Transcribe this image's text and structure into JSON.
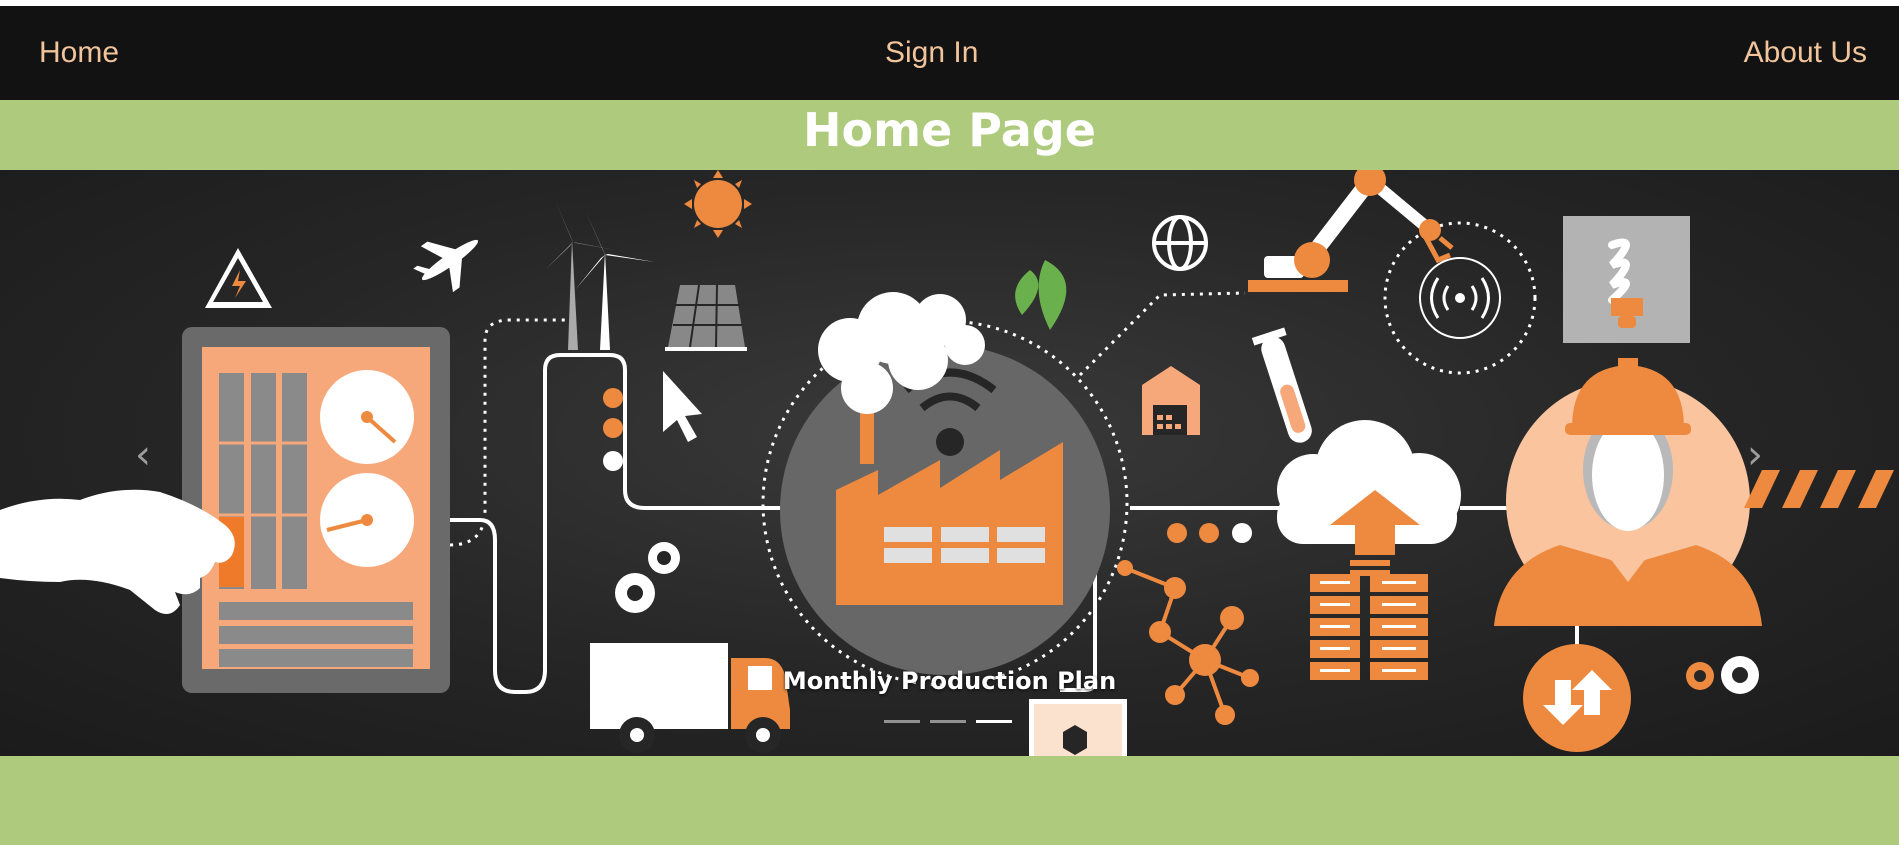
{
  "nav": {
    "home": "Home",
    "sign_in": "Sign In",
    "about_us": "About Us"
  },
  "banner": {
    "title": "Home Page"
  },
  "carousel": {
    "caption": "Monthly Production Plan",
    "slide_count": 3,
    "active_slide": 3,
    "prev_icon": "chevron-left-icon",
    "next_icon": "chevron-right-icon"
  },
  "colors": {
    "navbar_bg": "#121212",
    "nav_link": "#f2c49b",
    "banner_bg": "#aecb7d",
    "accent_orange": "#ee8a3f",
    "carousel_bg": "#262626"
  }
}
